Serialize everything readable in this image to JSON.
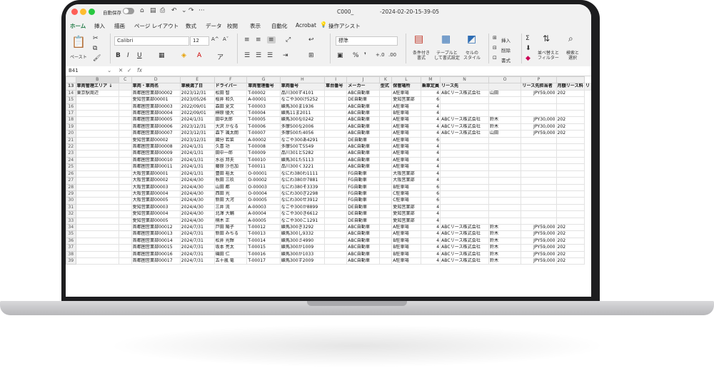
{
  "titlebar": {
    "autosave_label": "自動保存",
    "file_name": "C000_",
    "doc_suffix": "-2024-02-20-15-39-05"
  },
  "menu": {
    "tabs": [
      "ホーム",
      "挿入",
      "描画",
      "ページ レイアウト",
      "数式",
      "データ",
      "校閲",
      "表示",
      "自動化",
      "Acrobat"
    ],
    "assist_label": "操作アシスト"
  },
  "ribbon": {
    "paste_label": "ペースト",
    "font_name": "Calibri",
    "font_size": "12",
    "number_format": "標準",
    "conditional_label": "条件付き\n書式",
    "table_label": "テーブルと\nして書式設定",
    "cellstyle_label": "セルの\nスタイル",
    "insert_label": "挿入",
    "delete_label": "削除",
    "format_label": "書式",
    "sort_label": "並べ替えと\nフィルター",
    "find_label": "検索と\n選択",
    "accent": "#1f7a45"
  },
  "formula_bar": {
    "cell_ref": "B41",
    "fx_label": "fx"
  },
  "sheet": {
    "columns": [
      "",
      "B",
      "C",
      "D",
      "E",
      "F",
      "G",
      "H",
      "I",
      "J",
      "K",
      "L",
      "M",
      "N",
      "O",
      "P",
      ""
    ],
    "header_row_number": "13",
    "headers": [
      "車両管理エリア ↓",
      "",
      "車両・車両名",
      "車検満了日",
      "ドライバー",
      "車両管理番号",
      "車両番号",
      "車台番号",
      "メーカー",
      "型式",
      "保管場所",
      "乗車定員",
      "リース先",
      "",
      "リース先担当者",
      "月額リース料",
      "リ"
    ],
    "rows": [
      [
        "14",
        "東京駅周辺",
        "",
        "首都圏営業部00002",
        "2023/12/31",
        "松田 智",
        "T-00002",
        "品川300ず4101",
        "",
        "ABC自動車",
        "",
        "A駐車場",
        "4",
        "ABCリース株式会社",
        "山田",
        "JPY59,000",
        "202"
      ],
      [
        "15",
        "",
        "",
        "愛知営業部00001",
        "2023/05/26",
        "桜井 和久",
        "A-00001",
        "なごや300け5252",
        "",
        "DE自動車",
        "",
        "愛知営業部",
        "6",
        "",
        "",
        "",
        ""
      ],
      [
        "16",
        "",
        "",
        "首都圏営業部00003",
        "2022/09/01",
        "森田 夏文",
        "T-00003",
        "練馬300ま1936",
        "",
        "ABC自動車",
        "",
        "A駐車場",
        "4",
        "",
        "",
        "",
        ""
      ],
      [
        "17",
        "",
        "",
        "首都圏営業部00004",
        "2022/09/01",
        "榊原 優大",
        "T-00004",
        "練馬11ま2011",
        "",
        "ABC自動車",
        "",
        "B駐車場",
        "4",
        "",
        "",
        "",
        ""
      ],
      [
        "18",
        "",
        "",
        "首都圏営業部00005",
        "2024/1/31",
        "田中太郎",
        "T-00005",
        "練馬300な0242",
        "",
        "ABC自動車",
        "",
        "A駐車場",
        "4",
        "ABCリース株式会社",
        "鈴木",
        "JPY30,000",
        "202"
      ],
      [
        "19",
        "",
        "",
        "首都圏営業部00006",
        "2023/12/31",
        "大沢 かなる",
        "T-00006",
        "多摩500な2006",
        "",
        "ABC自動車",
        "",
        "A駐車場",
        "4",
        "ABCリース株式会社",
        "鈴木",
        "JPY30,000",
        "202"
      ],
      [
        "20",
        "",
        "",
        "首都圏営業部00007",
        "2023/12/31",
        "森下 颯太朗",
        "T-00007",
        "多摩500た4056",
        "",
        "ABC自動車",
        "",
        "A駐車場",
        "4",
        "ABCリース株式会社",
        "山田",
        "JPY59,000",
        "202"
      ],
      [
        "21",
        "",
        "",
        "愛知営業部00002",
        "2023/12/31",
        "國分 若菜",
        "A-00002",
        "なごや300あ4291",
        "",
        "DE自動車",
        "",
        "A駐車場",
        "6",
        "",
        "",
        "",
        ""
      ],
      [
        "22",
        "",
        "",
        "首都圏営業部00008",
        "2024/1/31",
        "久喜 功",
        "T-00008",
        "多摩500て5549",
        "",
        "ABC自動車",
        "",
        "A駐車場",
        "4",
        "",
        "",
        "",
        ""
      ],
      [
        "23",
        "",
        "",
        "首都圏営業部00009",
        "2024/1/31",
        "田中一郎",
        "T-00009",
        "品川301と5282",
        "",
        "ABC自動車",
        "",
        "A駐車場",
        "4",
        "",
        "",
        "",
        ""
      ],
      [
        "24",
        "",
        "",
        "首都圏営業部00010",
        "2024/1/31",
        "水谷 邦夫",
        "T-00010",
        "練馬301た5113",
        "",
        "ABC自動車",
        "",
        "A駐車場",
        "4",
        "",
        "",
        "",
        ""
      ],
      [
        "25",
        "",
        "",
        "首都圏営業部00011",
        "2024/1/31",
        "藤原 沙也加",
        "T-00011",
        "品川300く3221",
        "",
        "ABC自動車",
        "",
        "A駐車場",
        "4",
        "",
        "",
        "",
        ""
      ],
      [
        "26",
        "",
        "",
        "大阪営業部00001",
        "2024/1/31",
        "豊田 裕太",
        "O-00001",
        "なにわ380わ1111",
        "",
        "FG自動車",
        "",
        "大阪営業部",
        "4",
        "",
        "",
        "",
        ""
      ],
      [
        "27",
        "",
        "",
        "大阪営業部00002",
        "2024/4/30",
        "秋田 三玖",
        "O-00002",
        "なにわ380か7881",
        "",
        "FG自動車",
        "",
        "大阪営業部",
        "4",
        "",
        "",
        "",
        ""
      ],
      [
        "28",
        "",
        "",
        "大阪営業部00003",
        "2024/4/30",
        "山田 都",
        "O-00003",
        "なにわ380そ3339",
        "",
        "FG自動車",
        "",
        "B駐車場",
        "6",
        "",
        "",
        "",
        ""
      ],
      [
        "29",
        "",
        "",
        "大阪営業部00004",
        "2024/4/30",
        "西田 光",
        "O-00004",
        "なにわ300ぎ2298",
        "",
        "FG自動車",
        "",
        "C駐車場",
        "6",
        "",
        "",
        "",
        ""
      ],
      [
        "30",
        "",
        "",
        "大阪営業部00005",
        "2024/4/30",
        "新田 大河",
        "O-00005",
        "なにわ300せ3912",
        "",
        "FG自動車",
        "",
        "C駐車場",
        "6",
        "",
        "",
        "",
        ""
      ],
      [
        "31",
        "",
        "",
        "愛知営業部00003",
        "2024/4/30",
        "三井 流",
        "A-00003",
        "なごや300か8899",
        "",
        "DE自動車",
        "",
        "愛知営業部",
        "4",
        "",
        "",
        "",
        ""
      ],
      [
        "32",
        "",
        "",
        "愛知営業部00004",
        "2024/4/30",
        "北澤 大輔",
        "A-00004",
        "なごや300き6612",
        "",
        "DE自動車",
        "",
        "愛知営業部",
        "4",
        "",
        "",
        "",
        ""
      ],
      [
        "33",
        "",
        "",
        "愛知営業部00005",
        "2024/4/30",
        "楠木 正",
        "A-00005",
        "なごや300こ1291",
        "",
        "DE自動車",
        "",
        "愛知営業部",
        "4",
        "",
        "",
        "",
        ""
      ],
      [
        "34",
        "",
        "",
        "首都圏営業部00012",
        "2024/7/31",
        "戸田 陽子",
        "T-00012",
        "練馬300き3292",
        "",
        "ABC自動車",
        "",
        "A駐車場",
        "4",
        "ABCリース株式会社",
        "鈴木",
        "JPY59,000",
        "202"
      ],
      [
        "35",
        "",
        "",
        "首都圏営業部00013",
        "2024/7/31",
        "新田 みちる",
        "T-00013",
        "練馬300し9332",
        "",
        "ABC自動車",
        "",
        "A駐車場",
        "4",
        "ABCリース株式会社",
        "鈴木",
        "JPY59,000",
        "202"
      ],
      [
        "36",
        "",
        "",
        "首都圏営業部00014",
        "2024/7/31",
        "松井 光輝",
        "T-00014",
        "練馬300さ4990",
        "",
        "ABC自動車",
        "",
        "B駐車場",
        "4",
        "ABCリース株式会社",
        "鈴木",
        "JPY59,000",
        "202"
      ],
      [
        "37",
        "",
        "",
        "首都圏営業部00015",
        "2024/7/31",
        "坂本 亮太",
        "T-00015",
        "練馬300か1009",
        "",
        "ABC自動車",
        "",
        "B駐車場",
        "4",
        "ABCリース株式会社",
        "鈴木",
        "JPY59,000",
        "202"
      ],
      [
        "38",
        "",
        "",
        "首都圏営業部00016",
        "2024/7/31",
        "磯田 仁",
        "T-00016",
        "練馬300か1033",
        "",
        "ABC自動車",
        "",
        "B駐車場",
        "4",
        "ABCリース株式会社",
        "鈴木",
        "JPY59,000",
        "202"
      ],
      [
        "39",
        "",
        "",
        "首都圏営業部00017",
        "2024/7/31",
        "五十嵐 竜",
        "T-00017",
        "練馬300す2009",
        "",
        "ABC自動車",
        "",
        "A駐車場",
        "4",
        "ABCリース株式会社",
        "鈴木",
        "JPY59,000",
        "202"
      ]
    ]
  }
}
